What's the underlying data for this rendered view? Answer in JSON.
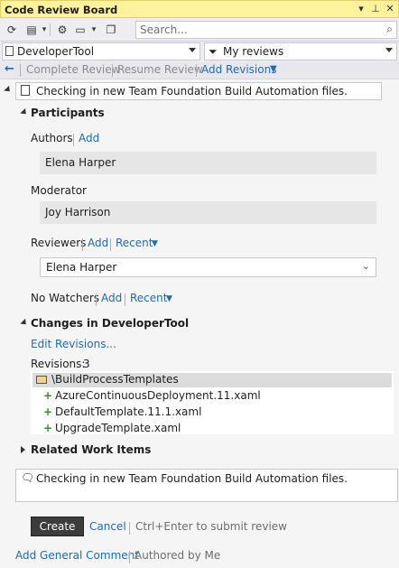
{
  "window": {
    "title": "Code Review Board",
    "title_buttons": [
      "dropdown-icon",
      "pin-icon",
      "close-icon"
    ]
  },
  "toolbar": {
    "search_placeholder": "Search...",
    "buttons": [
      "refresh-icon",
      "new-request-icon",
      "settings-icon",
      "layout-icon",
      "copy-icon"
    ]
  },
  "filters": {
    "project": "DeveloperTool",
    "query": "My reviews"
  },
  "actions": {
    "complete_review": "Complete Review",
    "resume_review": "Resume Review",
    "add_revisions": "Add Revisions"
  },
  "review": {
    "title": "Checking in new Team Foundation Build Automation files."
  },
  "participants": {
    "header": "Participants",
    "authors_label": "Authors",
    "authors_add": "Add",
    "author": "Elena Harper",
    "moderator_label": "Moderator",
    "moderator": "Joy Harrison",
    "reviewers_label": "Reviewers",
    "reviewers_add": "Add",
    "reviewers_recent": "Recent",
    "reviewer_selected": "Elena Harper",
    "watchers_label": "No Watchers",
    "watchers_add": "Add",
    "watchers_recent": "Recent"
  },
  "changes": {
    "header": "Changes in DeveloperTool",
    "edit_revisions": "Edit Revisions...",
    "revisions_label": "Revisions:",
    "revisions_count": "3",
    "folder": "\\BuildProcessTemplates",
    "files": [
      "AzureContinuousDeployment.11.xaml",
      "DefaultTemplate.11.1.xaml",
      "UpgradeTemplate.xaml"
    ]
  },
  "related": {
    "header": "Related Work Items"
  },
  "comment": {
    "text": "Checking in new Team Foundation Build Automation files."
  },
  "footer": {
    "create": "Create",
    "cancel": "Cancel",
    "hint": "Ctrl+Enter to submit review",
    "add_general_comment": "Add General Comment",
    "authored_by_me": "Authored by Me"
  }
}
